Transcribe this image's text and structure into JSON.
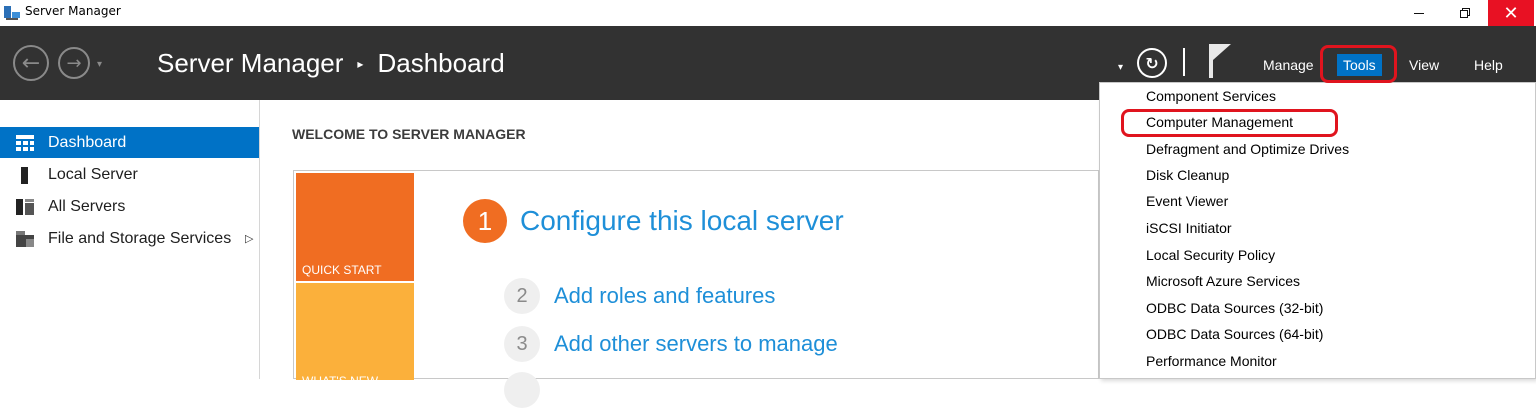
{
  "window": {
    "title": "Server Manager",
    "minimize_icon": "minimize-icon",
    "restore_icon": "restore-icon",
    "close_icon": "close-icon",
    "close_glyph": "✕"
  },
  "header": {
    "breadcrumb_root": "Server Manager",
    "breadcrumb_separator": "▸",
    "breadcrumb_page": "Dashboard",
    "back_glyph": "←",
    "forward_glyph": "→",
    "dropdown_glyph": "▾",
    "refresh_glyph": "↻",
    "menu": {
      "manage": "Manage",
      "tools": "Tools",
      "view": "View",
      "help": "Help"
    }
  },
  "sidebar": {
    "items": [
      {
        "label": "Dashboard",
        "icon": "dashboard-icon",
        "active": true
      },
      {
        "label": "Local Server",
        "icon": "local-server-icon",
        "active": false
      },
      {
        "label": "All Servers",
        "icon": "all-servers-icon",
        "active": false
      },
      {
        "label": "File and Storage Services",
        "icon": "file-storage-icon",
        "active": false
      }
    ],
    "expand_glyph": "▷"
  },
  "main": {
    "welcome_title": "WELCOME TO SERVER MANAGER",
    "tiles": {
      "quick_start": "QUICK START",
      "whats_new": "WHAT'S NEW"
    },
    "steps": [
      {
        "number": "1",
        "label": "Configure this local server"
      },
      {
        "number": "2",
        "label": "Add roles and features"
      },
      {
        "number": "3",
        "label": "Add other servers to manage"
      }
    ]
  },
  "tools_menu": {
    "items": [
      "Component Services",
      "Computer Management",
      "Defragment and Optimize Drives",
      "Disk Cleanup",
      "Event Viewer",
      "iSCSI Initiator",
      "Local Security Policy",
      "Microsoft Azure Services",
      "ODBC Data Sources (32-bit)",
      "ODBC Data Sources (64-bit)",
      "Performance Monitor"
    ]
  },
  "colors": {
    "header_bg": "#323232",
    "accent_blue": "#0072c6",
    "link_blue": "#1e8fd8",
    "quick_start_orange": "#f06d22",
    "whats_new_yellow": "#fbb03b",
    "annotation_red": "#e0141e"
  }
}
